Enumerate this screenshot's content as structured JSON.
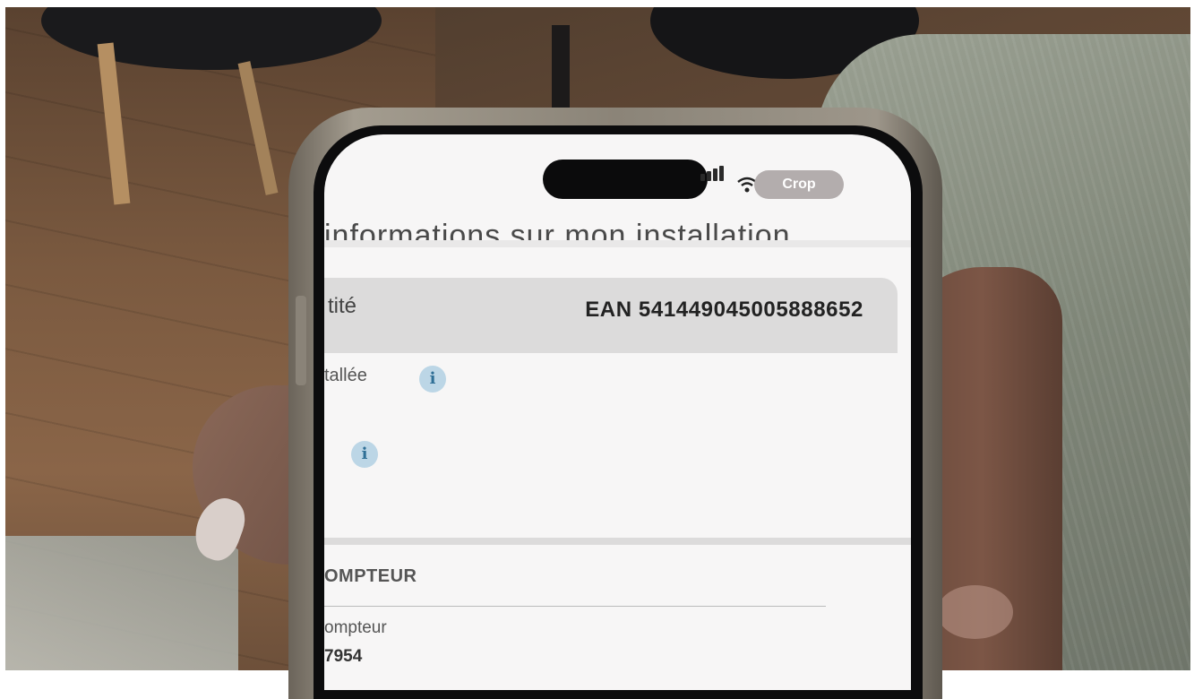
{
  "status_bar": {
    "crop_label": "Crop",
    "icons": [
      "signal-icon",
      "wifi-icon",
      "battery-icon"
    ]
  },
  "screen": {
    "heading": "informations sur mon installation",
    "ean_row": {
      "label": "tité",
      "value": "EAN 541449045005888652"
    },
    "rows": [
      {
        "label": "tallée",
        "icon": "info-icon",
        "icon_glyph": "i"
      },
      {
        "label": "",
        "icon": "info-icon",
        "icon_glyph": "i"
      }
    ],
    "section": {
      "title": "OMPTEUR",
      "meter_label": "ompteur",
      "meter_value": "7954"
    }
  },
  "colors": {
    "screen_bg": "#f7f6f6",
    "ean_row_bg": "#dcdbdb",
    "info_icon_bg": "#bcd6e6",
    "crop_button_bg": "#b3adad"
  }
}
